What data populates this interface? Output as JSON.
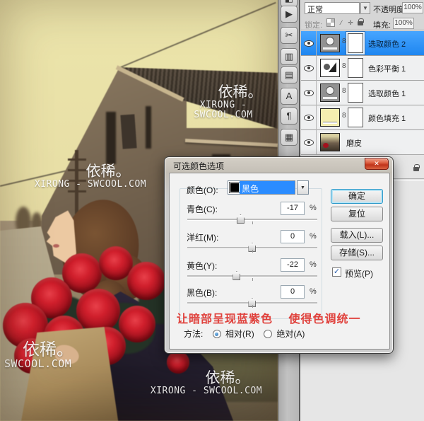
{
  "canvas": {
    "watermarks": [
      {
        "line1": "依稀。",
        "line2": "XIRONG - SWCOOL.COM"
      },
      {
        "line1": "依稀。",
        "line2": "XIRONG - SWCOOL.COM"
      },
      {
        "line1": "依稀。",
        "line2": "SWCOOL.COM"
      },
      {
        "line1": "依稀。",
        "line2": "XIRONG - SWCOOL.COM"
      }
    ]
  },
  "dock": {
    "icons": [
      {
        "name": "panel-thumb-partial",
        "glyph": "◧"
      },
      {
        "name": "actions-panel",
        "glyph": "▶"
      },
      {
        "name": "tool-presets-panel",
        "glyph": "✂"
      },
      {
        "name": "clone-source-panel",
        "glyph": "▥"
      },
      {
        "name": "layer-comps-panel",
        "glyph": "▤"
      },
      {
        "name": "character-panel",
        "glyph": "A"
      },
      {
        "name": "paragraph-panel",
        "glyph": "¶"
      },
      {
        "name": "histogram-panel",
        "glyph": "▦"
      }
    ]
  },
  "layers_panel": {
    "blend_mode": "正常",
    "blend_arrow": "▼",
    "opacity_label": "不透明度:",
    "opacity_value": "100%",
    "lock_label": "锁定:",
    "fill_label": "填充:",
    "fill_value": "100%",
    "link_glyph": "8",
    "layers": [
      {
        "name": "选取颜色 2",
        "selected": true
      },
      {
        "name": "色彩平衡 1",
        "selected": false
      },
      {
        "name": "选取颜色 1",
        "selected": false
      },
      {
        "name": "颜色填充 1",
        "selected": false
      },
      {
        "name": "磨皮",
        "selected": false
      }
    ]
  },
  "dialog": {
    "title": "可选颜色选项",
    "close_glyph": "✕",
    "color_label": "颜色(O):",
    "color_value": "黑色",
    "dropdown_arrow": "▼",
    "fields": [
      {
        "label": "青色(C):",
        "value": "-17",
        "unit": "%"
      },
      {
        "label": "洋红(M):",
        "value": "0",
        "unit": "%"
      },
      {
        "label": "黄色(Y):",
        "value": "-22",
        "unit": "%"
      },
      {
        "label": "黑色(B):",
        "value": "0",
        "unit": "%"
      }
    ],
    "buttons": [
      {
        "label": "确定"
      },
      {
        "label": "复位"
      },
      {
        "label": "载入(L)..."
      },
      {
        "label": "存储(S)..."
      }
    ],
    "preview": {
      "label": "预览(P)",
      "checked": true,
      "check_glyph": "✓"
    },
    "annotation": "让暗部呈现蓝紫色　 使得色调统一",
    "method": {
      "label": "方法:",
      "options": [
        {
          "label": "相对(R)",
          "selected": true
        },
        {
          "label": "绝对(A)",
          "selected": false
        }
      ]
    }
  },
  "colors": {
    "selection_blue": "#2e97ff",
    "annotation_red": "#e0413c",
    "close_button_red": "#c0331a",
    "fill_layer_yellow": "#f5eeb0",
    "sky_tint": "#ece5ab"
  }
}
